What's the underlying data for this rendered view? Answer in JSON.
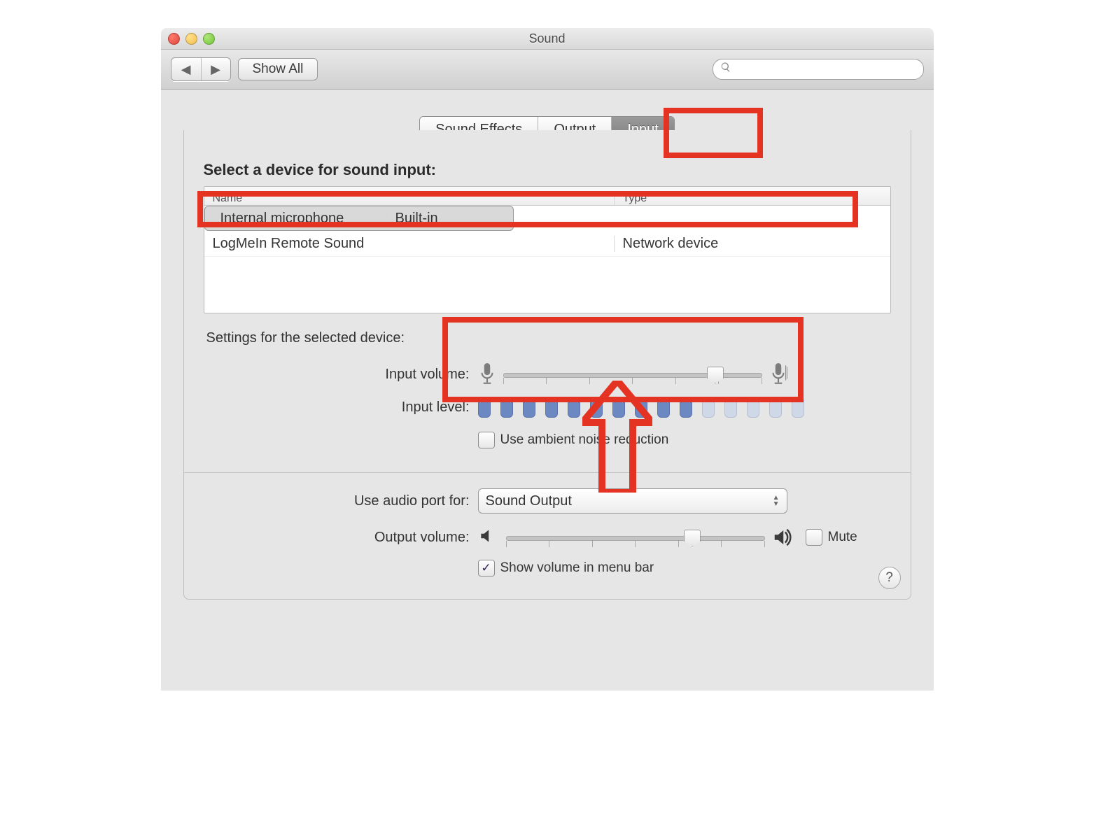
{
  "window": {
    "title": "Sound"
  },
  "toolbar": {
    "back_arrow": "◀",
    "fwd_arrow": "▶",
    "show_all": "Show All",
    "search_placeholder": ""
  },
  "tabs": {
    "effects": "Sound Effects",
    "output": "Output",
    "input": "Input"
  },
  "input_panel": {
    "heading": "Select a device for sound input:",
    "col_name": "Name",
    "col_type": "Type",
    "devices": [
      {
        "name": "Internal microphone",
        "type": "Built-in",
        "selected": true
      },
      {
        "name": "LogMeIn Remote Sound",
        "type": "Network device",
        "selected": false
      }
    ],
    "settings_label": "Settings for the selected device:",
    "input_volume_label": "Input volume:",
    "input_volume_percent": 82,
    "input_level_label": "Input level:",
    "input_level_bars_total": 15,
    "input_level_bars_active": 10,
    "ambient_label": "Use ambient noise reduction",
    "ambient_checked": false
  },
  "footer": {
    "audio_port_label": "Use audio port for:",
    "audio_port_value": "Sound Output",
    "output_volume_label": "Output volume:",
    "output_volume_percent": 72,
    "mute_label": "Mute",
    "mute_checked": false,
    "show_in_menu_label": "Show volume in menu bar",
    "show_in_menu_checked": true,
    "help_glyph": "?"
  },
  "colors": {
    "annotation": "#e53323"
  }
}
